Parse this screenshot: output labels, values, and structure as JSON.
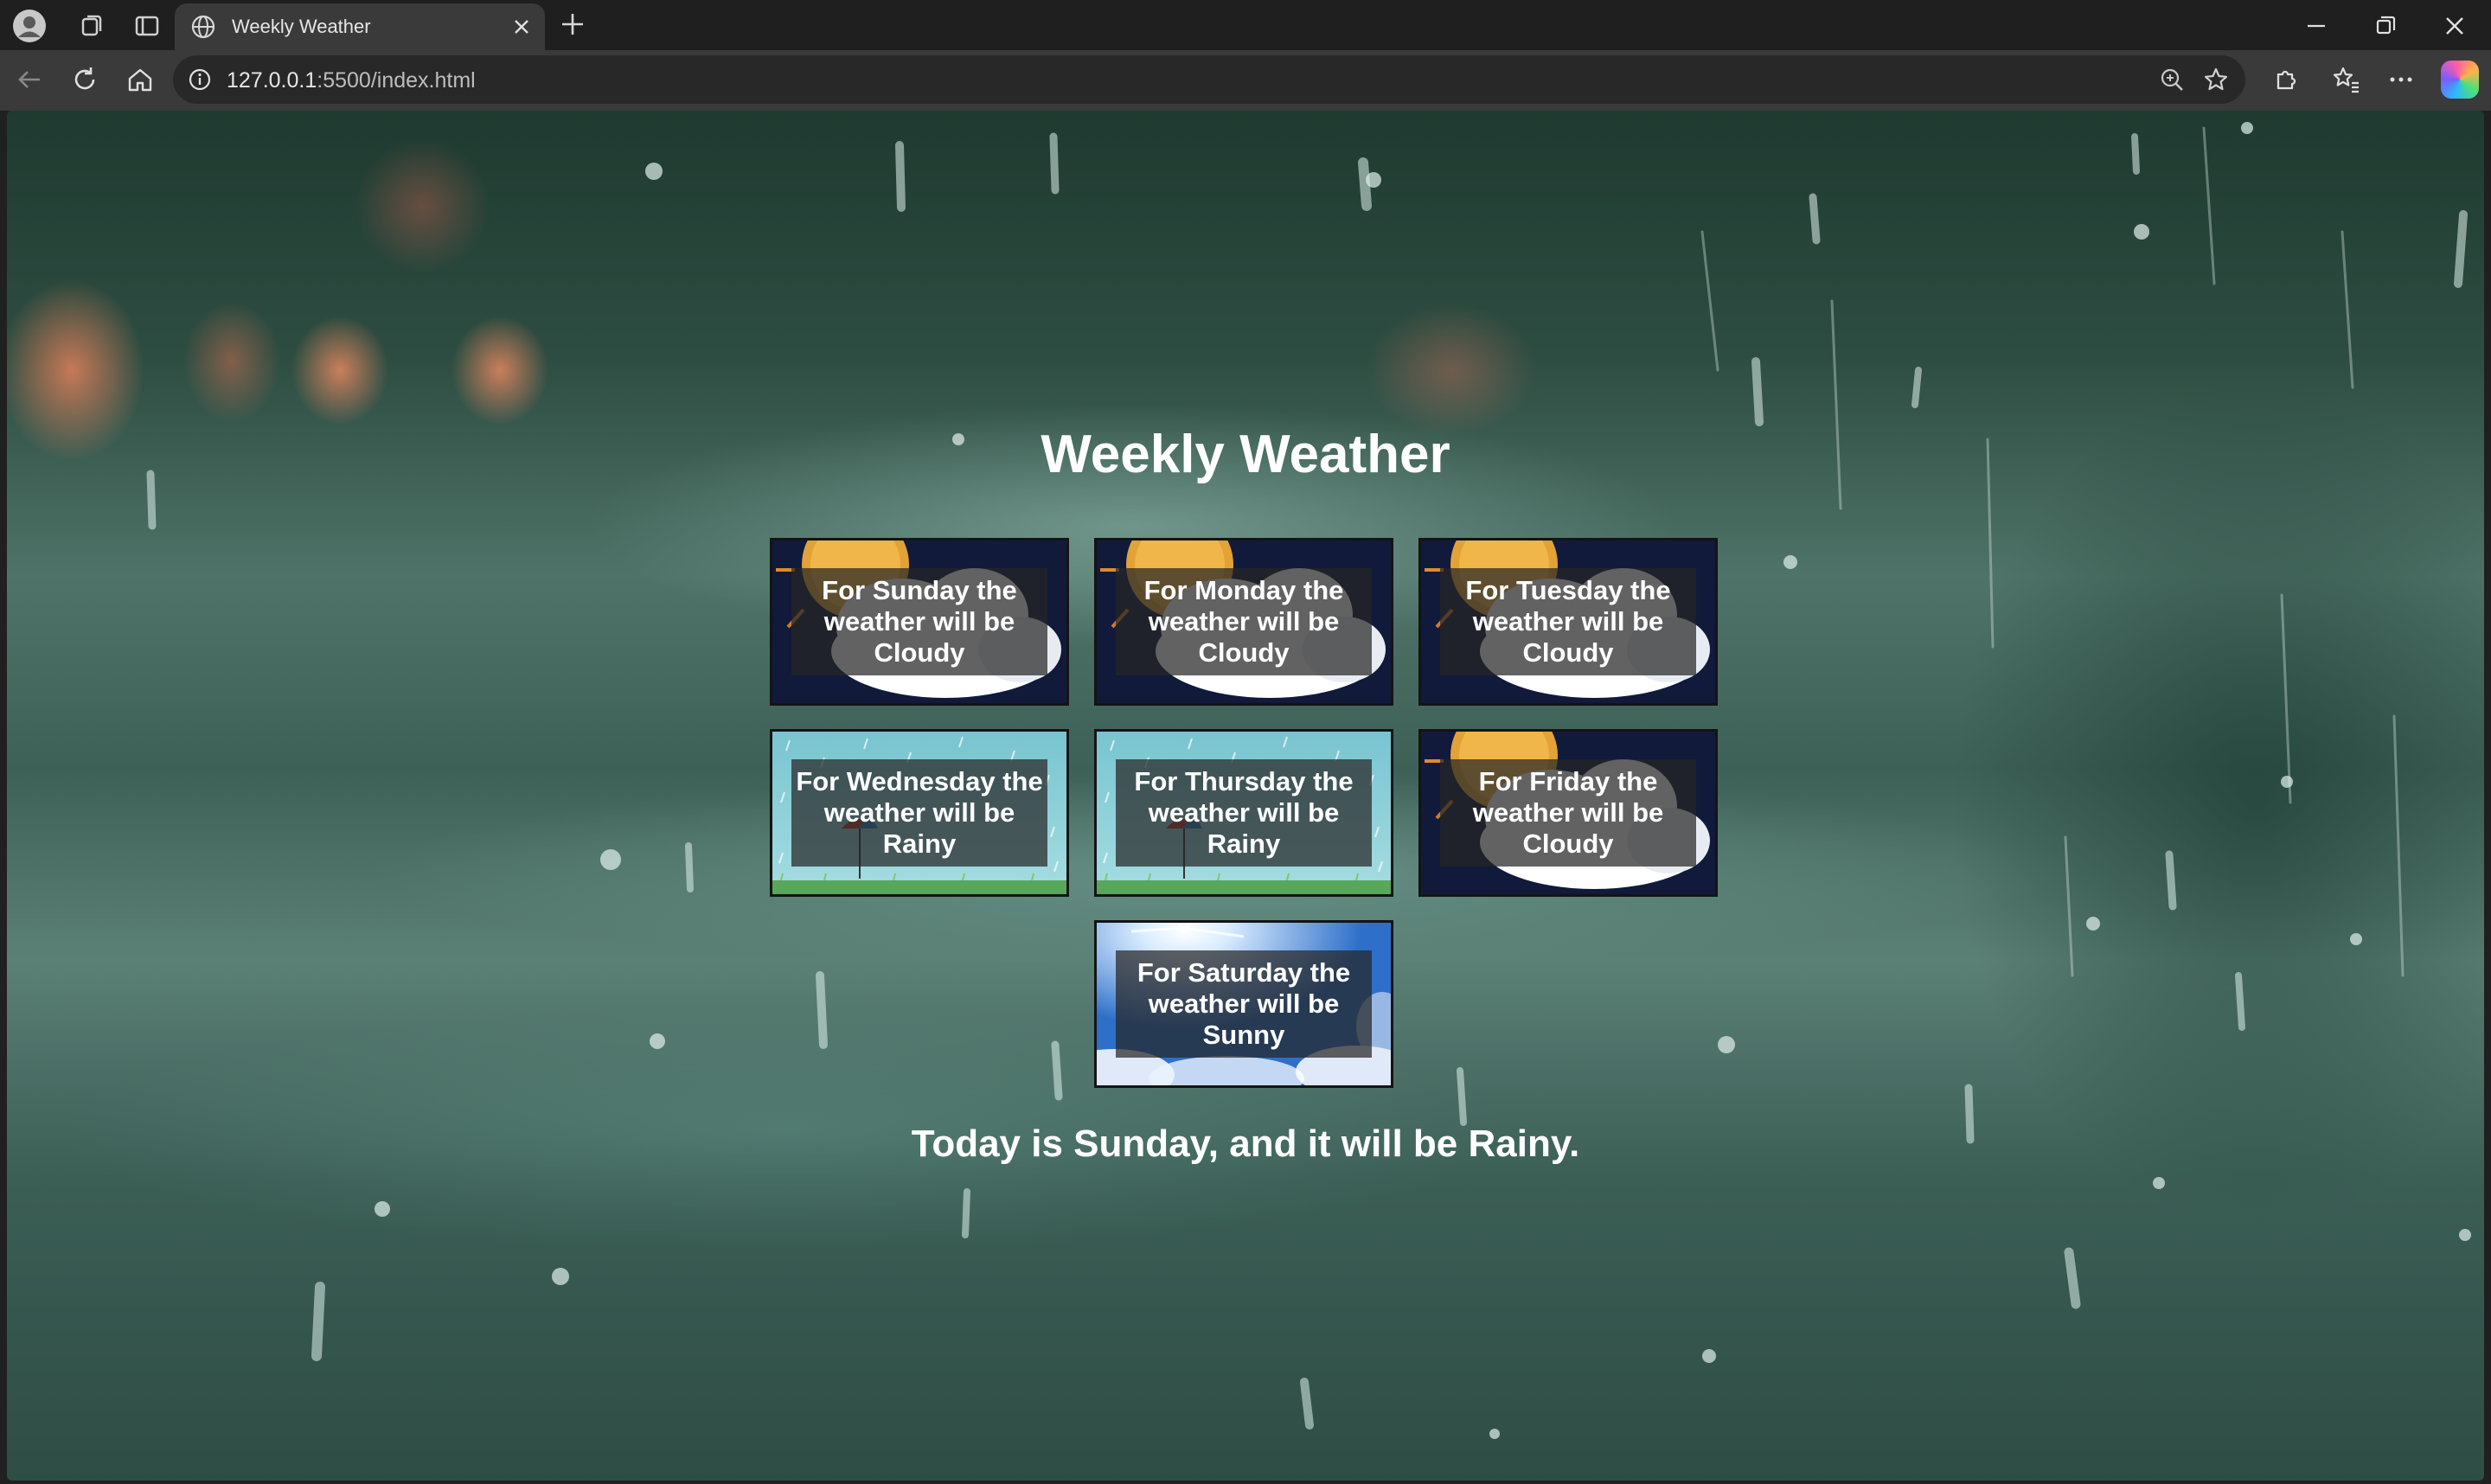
{
  "browser": {
    "tab_title": "Weekly Weather",
    "url_host": "127.0.0.1",
    "url_path": ":5500/index.html"
  },
  "page": {
    "title": "Weekly Weather",
    "today_text": "Today is Sunday, and it will be Rainy.",
    "cards": [
      {
        "day": "Sunday",
        "weather": "Cloudy",
        "text": "For Sunday the weather will be Cloudy"
      },
      {
        "day": "Monday",
        "weather": "Cloudy",
        "text": "For Monday the weather will be Cloudy"
      },
      {
        "day": "Tuesday",
        "weather": "Cloudy",
        "text": "For Tuesday the weather will be Cloudy"
      },
      {
        "day": "Wednesday",
        "weather": "Rainy",
        "text": "For Wednesday the weather will be Rainy"
      },
      {
        "day": "Thursday",
        "weather": "Rainy",
        "text": "For Thursday the weather will be Rainy"
      },
      {
        "day": "Friday",
        "weather": "Cloudy",
        "text": "For Friday the weather will be Cloudy"
      },
      {
        "day": "Saturday",
        "weather": "Sunny",
        "text": "For Saturday the weather will be Sunny"
      }
    ]
  },
  "colors": {
    "caption_bg": "#262626",
    "cloudy_bg": "#111a3a",
    "rainy_bg": "#8fd0d8",
    "sunny_bg": "#3e7fd6"
  }
}
